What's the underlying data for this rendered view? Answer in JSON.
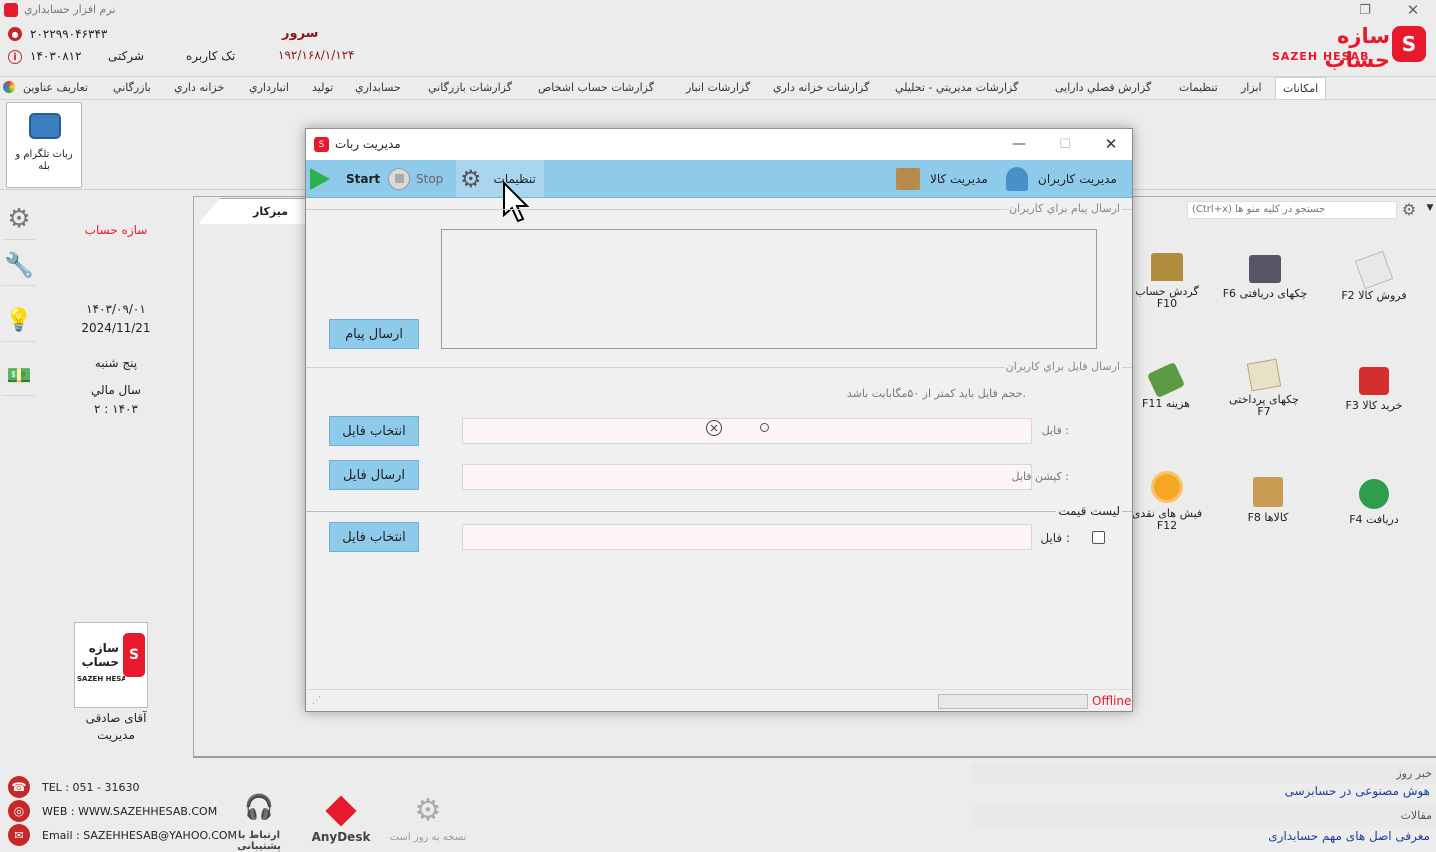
{
  "app_title": "نرم افزار حسابداري",
  "brand": {
    "name_fa": "سازه حساب",
    "name_en": "SAZEH HESAB",
    "color": "#e8192c"
  },
  "header": {
    "serial": "۲۰۲۲۹۹۰۴۶۳۴۳",
    "code": "۱۴۰۳۰۸۱۲",
    "company_type": "شرکتی",
    "user_type": "تک کاربره",
    "server_label": "سرور",
    "server_ip": "۱۹۲/۱۶۸/۱/۱۲۴"
  },
  "menu": {
    "items": [
      "امکانات",
      "ابزار",
      "تنظیمات",
      "گزارش فصلي دارایی",
      "گزارشات مديريتي - تحليلي",
      "گزارشات خزانه داري",
      "گزارشات انبار",
      "گزارشات حساب اشخاص",
      "گزارشات بازرگاني",
      "حسابداري",
      "توليد",
      "انبارداري",
      "خزانه داري",
      "بازرگاني",
      "تعاریف عناوین"
    ],
    "active": "امکانات"
  },
  "ribbon": {
    "telegram_bot_label": "ربات تلگرام و بله"
  },
  "info_panel": {
    "company": "سازه حساب",
    "date_fa": "۱۴۰۳/۰۹/۰۱",
    "date_en": "2024/11/21",
    "weekday": "پنج شنبه",
    "fiscal_label": "سال مالي",
    "fiscal_value": "۲ : ۱۴۰۳",
    "user_name": "آقای صادقی",
    "user_role": "مديريت"
  },
  "desk": {
    "tab_label": "میزکار",
    "search_placeholder": "(Ctrl+x)  جستجو در کلیه منو ها",
    "shortcuts": {
      "f2": {
        "label": "F2   فروش کالا",
        "icon": "invoice-icon"
      },
      "f6": {
        "label": "F6   چکهای دریافتی",
        "icon": "cheque-icon"
      },
      "f10": {
        "label": "گردش حساب",
        "label2": "F10",
        "icon": "bank-icon"
      },
      "f3": {
        "label": "F3   خرید کالا",
        "icon": "purchase-icon"
      },
      "f7": {
        "label": "چکهای پرداختی",
        "label2": "F7",
        "icon": "pay-cheque-icon"
      },
      "f11": {
        "label": "F11   هزینه",
        "icon": "expense-icon"
      },
      "f4": {
        "label": "F4   دریافت",
        "icon": "receive-icon"
      },
      "f8": {
        "label": "F8   کالاها",
        "icon": "goods-icon"
      },
      "f12": {
        "label": "فیش های نقدی",
        "label2": "F12",
        "icon": "receipt-icon"
      }
    }
  },
  "footer": {
    "tel": "TEL : 051 - 31630",
    "web": "WEB : WWW.SAZEHHESAB.COM",
    "email": "Email : SAZEHHESAB@YAHOO.COM",
    "support": "ارتباط با پشتیبانی",
    "anydesk": "AnyDesk",
    "update": "نسخه به روز است",
    "news_title": "خبر روز",
    "news_item": "هوش مصنوعی در حسابرسی",
    "articles_title": "مقالات",
    "article_item": "معرفی اصل های مهم حسابداری"
  },
  "dialog": {
    "title": "مديريت ربات",
    "toolbar": {
      "users": "مديريت کاربران",
      "goods": "مديريت کالا",
      "settings": "تنظيمات",
      "stop": "Stop",
      "start": "Start"
    },
    "message_section": "ارسال پيام براي کاربران",
    "send_message": "ارسال پيام",
    "file_section": "ارسال فايل براي کاربران",
    "file_hint": "حجم فايل بايد کمتر از ۵۰مگابايت باشد.",
    "file_label": "فايل :",
    "caption_label": "کپشن فايل :",
    "choose_file": "انتخاب فايل",
    "send_file": "ارسال فايل",
    "price_section": "ليست قيمت",
    "price_file_label": "فايل :",
    "choose_file2": "انتخاب فايل",
    "status": "Offline"
  }
}
